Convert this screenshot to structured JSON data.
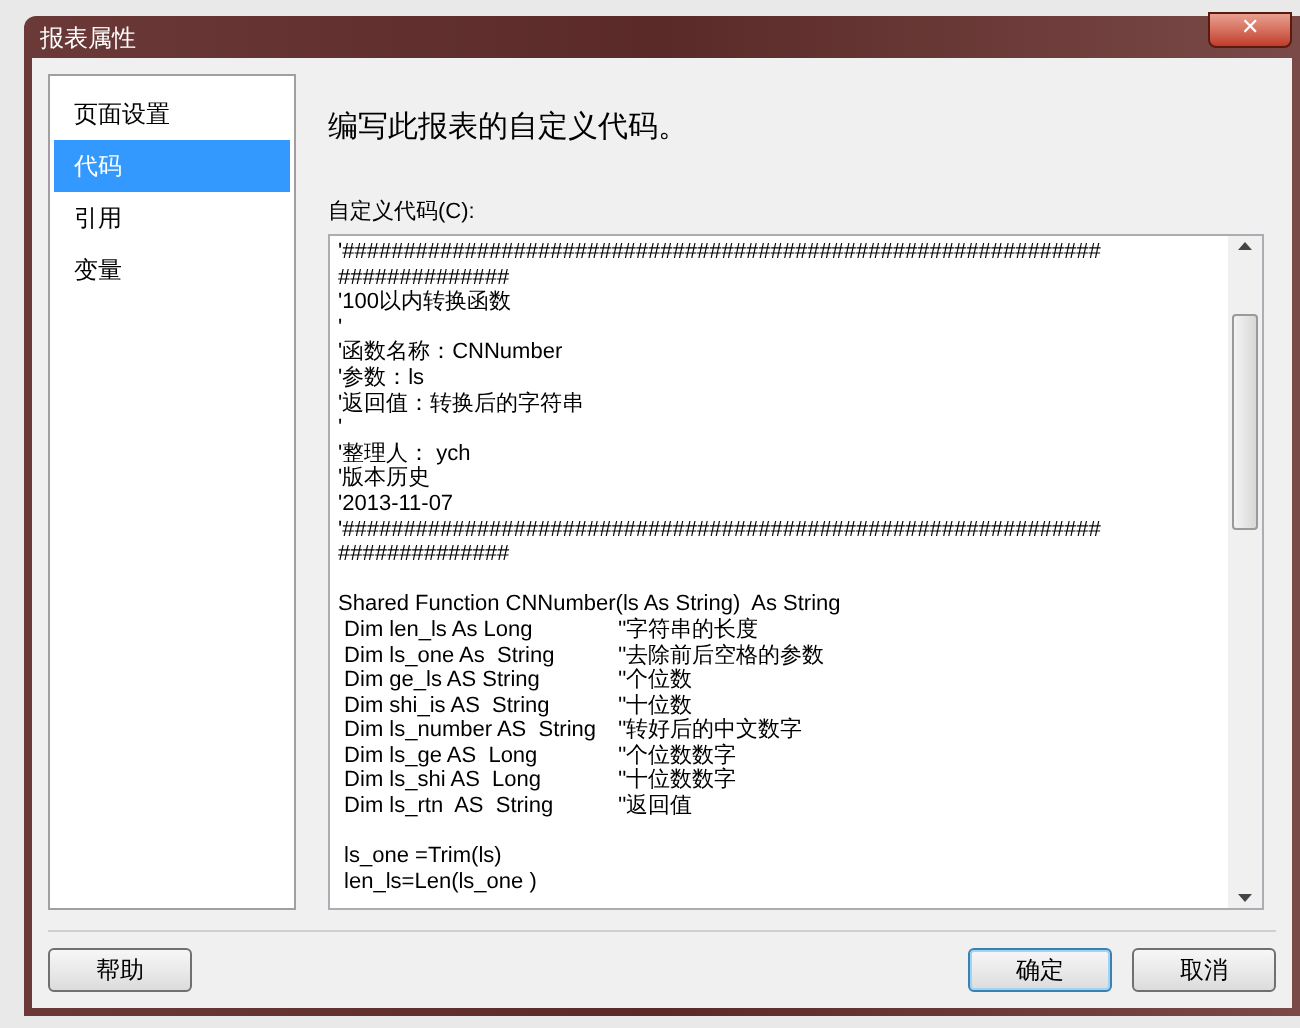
{
  "window": {
    "title": "报表属性",
    "close": "✕"
  },
  "sidebar": {
    "items": [
      {
        "label": "页面设置",
        "selected": false
      },
      {
        "label": "代码",
        "selected": true
      },
      {
        "label": "引用",
        "selected": false
      },
      {
        "label": "变量",
        "selected": false
      }
    ]
  },
  "heading": "编写此报表的自定义代码。",
  "code_field": {
    "label": "自定义代码(C):",
    "blocks": [
      [
        {
          "code": "'##############################################################"
        },
        {
          "code": "##############"
        },
        {
          "code": "'100以内转换函数"
        },
        {
          "code": "'"
        },
        {
          "code": "'函数名称：CNNumber"
        },
        {
          "code": "'参数：ls"
        },
        {
          "code": "'返回值：转换后的字符串"
        },
        {
          "code": "'"
        },
        {
          "code": "'整理人： ych"
        },
        {
          "code": "'版本历史"
        },
        {
          "code": "'2013-11-07"
        },
        {
          "code": "'##############################################################"
        },
        {
          "code": "##############"
        }
      ],
      [
        {
          "code": "Shared Function CNNumber(ls As String)  As String"
        },
        {
          "code": " Dim len_ls As Long",
          "comment": "''字符串的长度"
        },
        {
          "code": " Dim ls_one As  String",
          "comment": "''去除前后空格的参数"
        },
        {
          "code": " Dim ge_ls AS String",
          "comment": "''个位数"
        },
        {
          "code": " Dim shi_is AS  String",
          "comment": "''十位数"
        },
        {
          "code": " Dim ls_number AS  String",
          "comment": "''转好后的中文数字"
        },
        {
          "code": " Dim ls_ge AS  Long",
          "comment": "''个位数数字"
        },
        {
          "code": " Dim ls_shi AS  Long",
          "comment": "''十位数数字"
        },
        {
          "code": " Dim ls_rtn  AS  String",
          "comment": "''返回值"
        }
      ],
      [
        {
          "code": " ls_one =Trim(ls)"
        },
        {
          "code": " len_ls=Len(ls_one )"
        }
      ]
    ]
  },
  "buttons": [
    {
      "label": "帮助",
      "default": false
    },
    {
      "label": "确定",
      "default": true
    },
    {
      "label": "取消",
      "default": false
    }
  ]
}
